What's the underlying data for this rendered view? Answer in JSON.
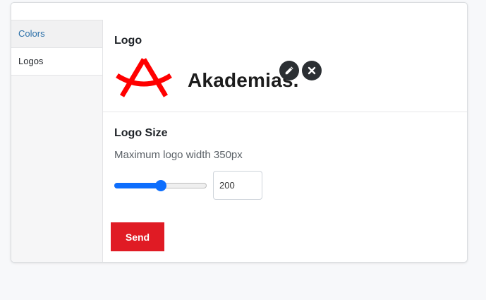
{
  "sidebar": {
    "items": [
      {
        "label": "Colors",
        "active": false
      },
      {
        "label": "Logos",
        "active": true
      }
    ]
  },
  "logo_section": {
    "title": "Logo",
    "brand_text": "Akademias.",
    "brand_color": "#ff0000",
    "actions": {
      "edit_icon": "pencil-icon",
      "delete_icon": "close-icon"
    }
  },
  "logo_size": {
    "title": "Logo Size",
    "hint": "Maximum logo width 350px",
    "slider_fraction": 0.5,
    "value": "200"
  },
  "send_label": "Send",
  "colors": {
    "accent": "#0d6efd",
    "send_button": "#e01b24",
    "link": "#2a6fa8"
  }
}
